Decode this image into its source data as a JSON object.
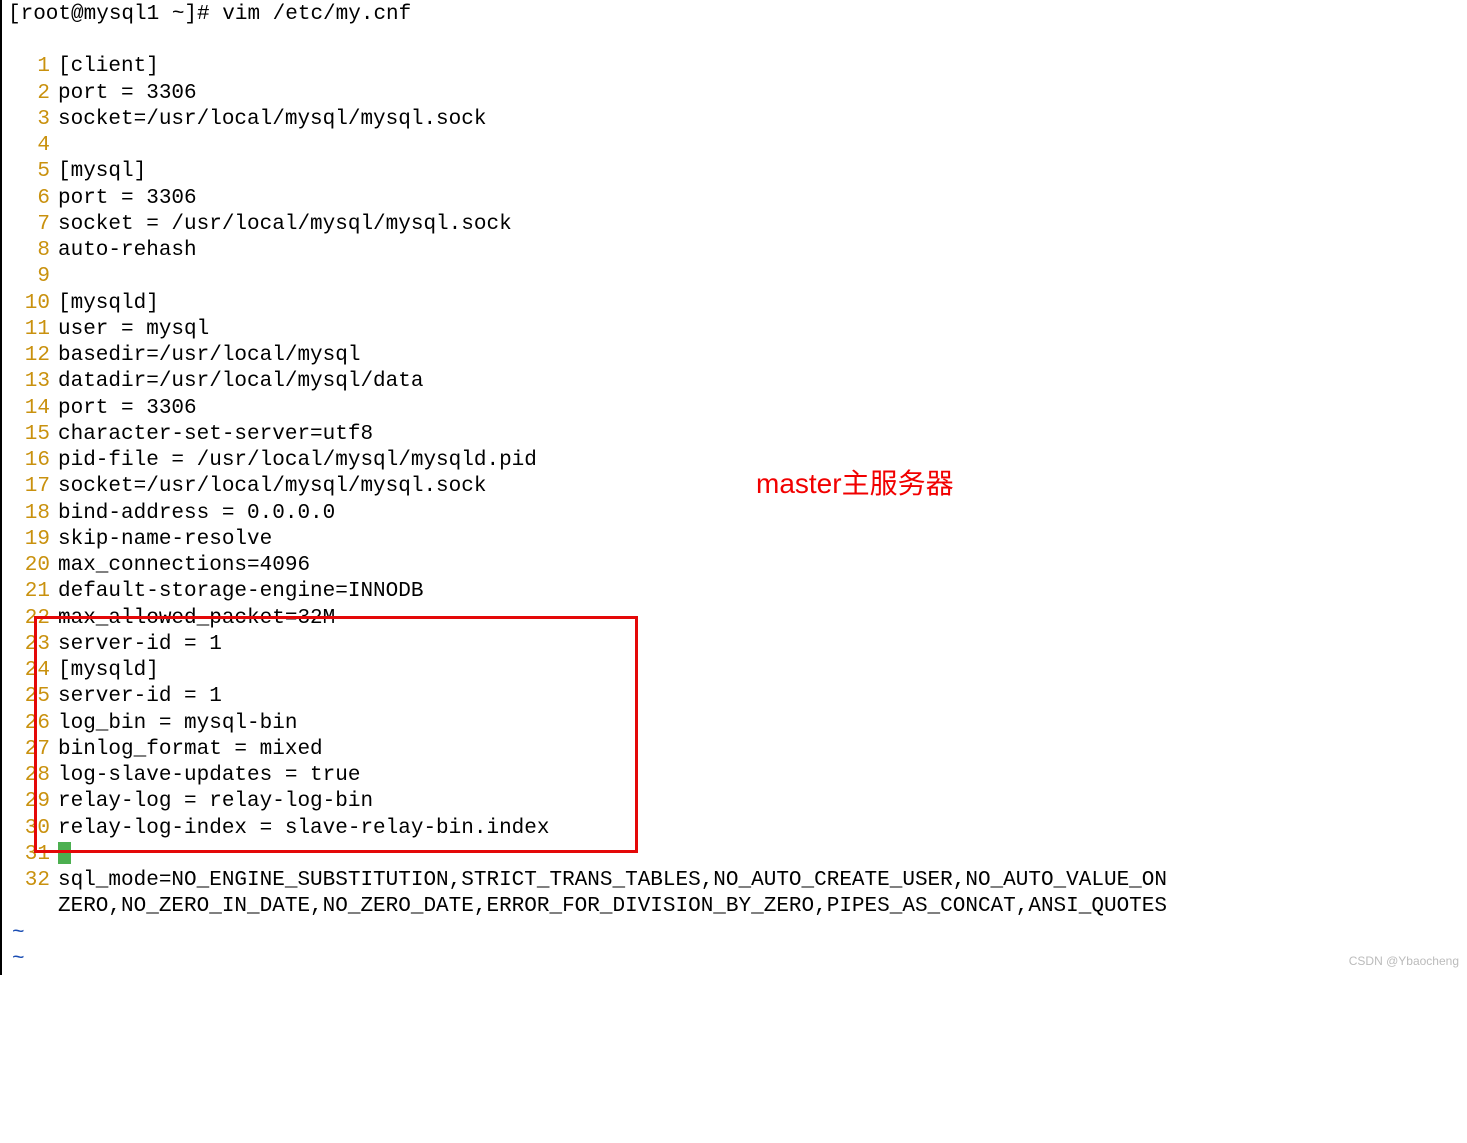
{
  "prompt": "[root@mysql1 ~]# vim /etc/my.cnf",
  "lines": [
    {
      "n": "1",
      "t": "[client]"
    },
    {
      "n": "2",
      "t": "port = 3306"
    },
    {
      "n": "3",
      "t": "socket=/usr/local/mysql/mysql.sock"
    },
    {
      "n": "4",
      "t": ""
    },
    {
      "n": "5",
      "t": "[mysql]"
    },
    {
      "n": "6",
      "t": "port = 3306"
    },
    {
      "n": "7",
      "t": "socket = /usr/local/mysql/mysql.sock"
    },
    {
      "n": "8",
      "t": "auto-rehash"
    },
    {
      "n": "9",
      "t": ""
    },
    {
      "n": "10",
      "t": "[mysqld]"
    },
    {
      "n": "11",
      "t": "user = mysql"
    },
    {
      "n": "12",
      "t": "basedir=/usr/local/mysql"
    },
    {
      "n": "13",
      "t": "datadir=/usr/local/mysql/data"
    },
    {
      "n": "14",
      "t": "port = 3306"
    },
    {
      "n": "15",
      "t": "character-set-server=utf8"
    },
    {
      "n": "16",
      "t": "pid-file = /usr/local/mysql/mysqld.pid"
    },
    {
      "n": "17",
      "t": "socket=/usr/local/mysql/mysql.sock"
    },
    {
      "n": "18",
      "t": "bind-address = 0.0.0.0"
    },
    {
      "n": "19",
      "t": "skip-name-resolve"
    },
    {
      "n": "20",
      "t": "max_connections=4096"
    },
    {
      "n": "21",
      "t": "default-storage-engine=INNODB"
    },
    {
      "n": "22",
      "t": "max_allowed_packet=32M"
    },
    {
      "n": "23",
      "t": "server-id = 1"
    },
    {
      "n": "24",
      "t": "[mysqld]"
    },
    {
      "n": "25",
      "t": "server-id = 1"
    },
    {
      "n": "26",
      "t": "log_bin = mysql-bin"
    },
    {
      "n": "27",
      "t": "binlog_format = mixed"
    },
    {
      "n": "28",
      "t": "log-slave-updates = true"
    },
    {
      "n": "29",
      "t": "relay-log = relay-log-bin"
    },
    {
      "n": "30",
      "t": "relay-log-index = slave-relay-bin.index"
    },
    {
      "n": "31",
      "t": ""
    },
    {
      "n": "32",
      "t": "sql_mode=NO_ENGINE_SUBSTITUTION,STRICT_TRANS_TABLES,NO_AUTO_CREATE_USER,NO_AUTO_VALUE_ON_ZERO,NO_ZERO_IN_DATE,NO_ZERO_DATE,ERROR_FOR_DIVISION_BY_ZERO,PIPES_AS_CONCAT,ANSI_QUOTES"
    }
  ],
  "cursor_line": "31",
  "annotation": "master主服务器",
  "tilde": "~",
  "watermark": "CSDN @Ybaocheng"
}
